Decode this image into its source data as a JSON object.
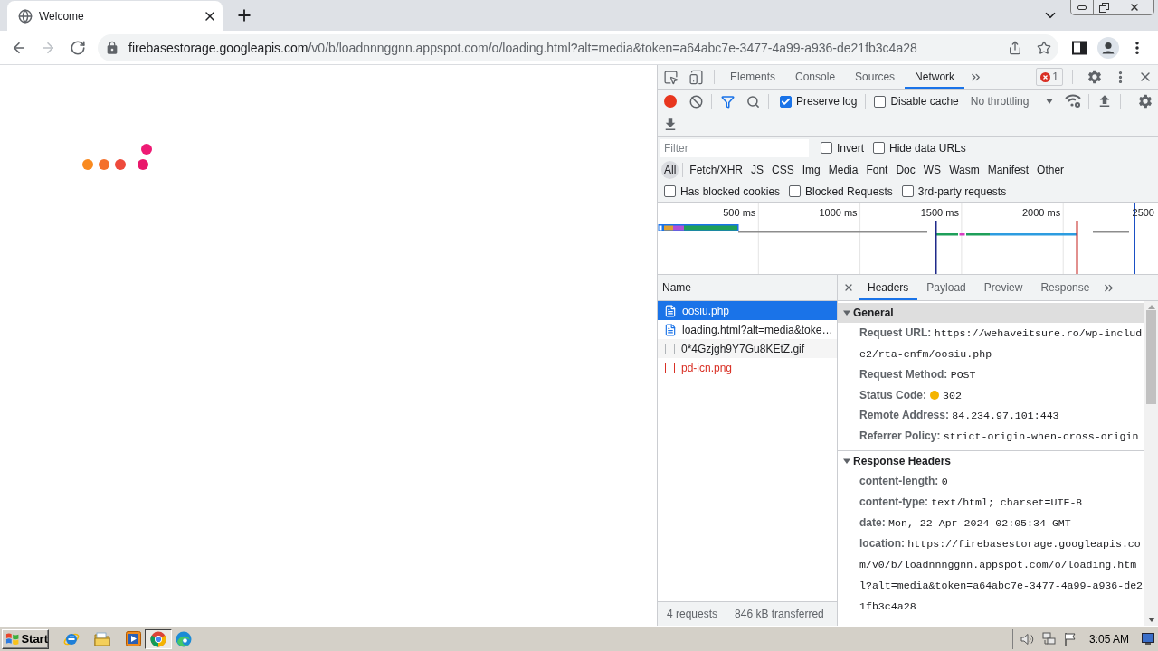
{
  "browser": {
    "tab": {
      "title": "Welcome"
    },
    "nav": [
      {
        "kind": "back",
        "disabled": false
      },
      {
        "kind": "forward",
        "disabled": true
      },
      {
        "kind": "reload",
        "disabled": false
      }
    ],
    "address": {
      "host": "firebasestorage.googleapis.com",
      "path": "/v0/b/loadnnnggnn.appspot.com/o/loading.html?alt=media&token=a64abc7e-3477-4a99-a936-de21fb3c4a28"
    }
  },
  "page": {
    "loader_dots": [
      {
        "color": "#f98a1f"
      },
      {
        "color": "#f4702c"
      },
      {
        "color": "#ee4a3c"
      },
      {
        "color": "#e9186b"
      },
      {
        "color": "#ee1a74"
      }
    ]
  },
  "devtools": {
    "panel_tabs": [
      {
        "label": "Elements",
        "selected": false
      },
      {
        "label": "Console",
        "selected": false
      },
      {
        "label": "Sources",
        "selected": false
      },
      {
        "label": "Network",
        "selected": true
      }
    ],
    "error_count": "1",
    "toolbar": {
      "recording": true,
      "options": [
        {
          "label": "Preserve log",
          "checked": true
        },
        {
          "label": "Disable cache",
          "checked": false
        }
      ],
      "throttling": "No throttling"
    },
    "filter": {
      "placeholder": "Filter",
      "options": [
        {
          "label": "Invert",
          "checked": false
        },
        {
          "label": "Hide data URLs",
          "checked": false
        }
      ]
    },
    "types": [
      {
        "label": "All",
        "selected": true
      },
      {
        "label": "Fetch/XHR",
        "selected": false
      },
      {
        "label": "JS",
        "selected": false
      },
      {
        "label": "CSS",
        "selected": false
      },
      {
        "label": "Img",
        "selected": false
      },
      {
        "label": "Media",
        "selected": false
      },
      {
        "label": "Font",
        "selected": false
      },
      {
        "label": "Doc",
        "selected": false
      },
      {
        "label": "WS",
        "selected": false
      },
      {
        "label": "Wasm",
        "selected": false
      },
      {
        "label": "Manifest",
        "selected": false
      },
      {
        "label": "Other",
        "selected": false
      }
    ],
    "more_filters": [
      {
        "label": "Has blocked cookies",
        "checked": false
      },
      {
        "label": "Blocked Requests",
        "checked": false
      },
      {
        "label": "3rd-party requests",
        "checked": false
      }
    ],
    "timeline": {
      "ticks": [
        "500 ms",
        "1000 ms",
        "1500 ms",
        "2000 ms",
        "2500"
      ]
    },
    "requests": {
      "column": "Name",
      "rows": [
        {
          "name": "oosiu.php",
          "kind": "document",
          "selected": true,
          "failed": false
        },
        {
          "name": "loading.html?alt=media&toke…",
          "kind": "document",
          "selected": false,
          "failed": false
        },
        {
          "name": "0*4Gzjgh9Y7Gu8KEtZ.gif",
          "kind": "image",
          "selected": false,
          "failed": false
        },
        {
          "name": "pd-icn.png",
          "kind": "image",
          "selected": false,
          "failed": true
        }
      ],
      "summary": [
        "4 requests",
        "846 kB transferred"
      ]
    },
    "details": {
      "tabs": [
        {
          "label": "Headers",
          "selected": true
        },
        {
          "label": "Payload",
          "selected": false
        },
        {
          "label": "Preview",
          "selected": false
        },
        {
          "label": "Response",
          "selected": false
        }
      ],
      "sections": [
        {
          "title": "General",
          "expanded": true,
          "focused": true,
          "fields": [
            {
              "kind": "text",
              "name": "Request URL:",
              "value": "https://wehaveitsure.ro/wp-include2/rta-cnfm/oosiu.php"
            },
            {
              "kind": "text",
              "name": "Request Method:",
              "value": "POST"
            },
            {
              "kind": "status",
              "name": "Status Code:",
              "value": "302"
            },
            {
              "kind": "text",
              "name": "Remote Address:",
              "value": "84.234.97.101:443"
            },
            {
              "kind": "text",
              "name": "Referrer Policy:",
              "value": "strict-origin-when-cross-origin"
            }
          ]
        },
        {
          "title": "Response Headers",
          "expanded": true,
          "focused": false,
          "fields": [
            {
              "kind": "text",
              "name": "content-length:",
              "value": "0"
            },
            {
              "kind": "text",
              "name": "content-type:",
              "value": "text/html; charset=UTF-8"
            },
            {
              "kind": "text",
              "name": "date:",
              "value": "Mon, 22 Apr 2024 02:05:34 GMT"
            },
            {
              "kind": "text",
              "name": "location:",
              "value": "https://firebasestorage.googleapis.com/v0/b/loadnnnggnn.appspot.com/o/loading.html?alt=media&token=a64abc7e-3477-4a99-a936-de21fb3c4a28"
            }
          ]
        }
      ]
    }
  },
  "taskbar": {
    "start": "Start",
    "apps": [
      {
        "kind": "explorer",
        "active": false
      },
      {
        "kind": "folder",
        "active": false
      },
      {
        "kind": "media",
        "active": false
      },
      {
        "kind": "chrome",
        "active": true
      },
      {
        "kind": "edge",
        "active": false
      }
    ],
    "clock": "3:05 AM"
  }
}
